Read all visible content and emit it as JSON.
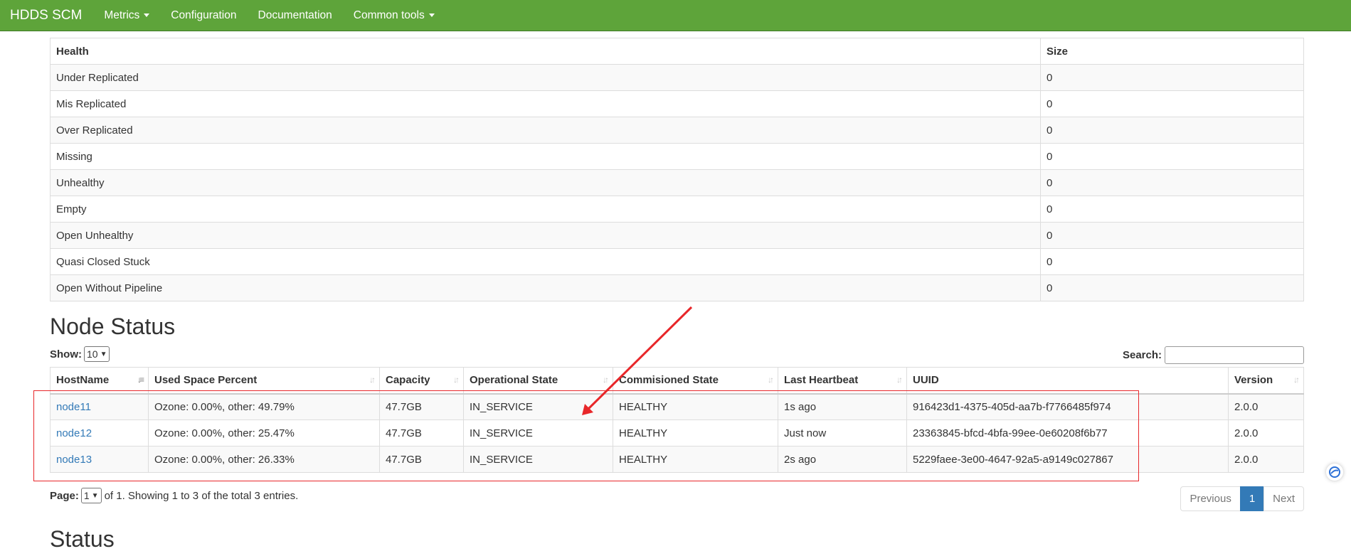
{
  "navbar": {
    "brand": "HDDS SCM",
    "items": [
      {
        "label": "Metrics",
        "dropdown": true
      },
      {
        "label": "Configuration",
        "dropdown": false
      },
      {
        "label": "Documentation",
        "dropdown": false
      },
      {
        "label": "Common tools",
        "dropdown": true
      }
    ]
  },
  "health_table": {
    "headers": [
      "Health",
      "Size"
    ],
    "rows": [
      [
        "Under Replicated",
        "0"
      ],
      [
        "Mis Replicated",
        "0"
      ],
      [
        "Over Replicated",
        "0"
      ],
      [
        "Missing",
        "0"
      ],
      [
        "Unhealthy",
        "0"
      ],
      [
        "Empty",
        "0"
      ],
      [
        "Open Unhealthy",
        "0"
      ],
      [
        "Quasi Closed Stuck",
        "0"
      ],
      [
        "Open Without Pipeline",
        "0"
      ]
    ]
  },
  "node_status": {
    "title": "Node Status",
    "show_label": "Show:",
    "show_value": "10",
    "search_label": "Search:",
    "search_value": "",
    "headers": [
      "HostName",
      "Used Space Percent",
      "Capacity",
      "Operational State",
      "Commisioned State",
      "Last Heartbeat",
      "UUID",
      "Version"
    ],
    "rows": [
      [
        "node11",
        "Ozone: 0.00%, other: 49.79%",
        "47.7GB",
        "IN_SERVICE",
        "HEALTHY",
        "1s ago",
        "916423d1-4375-405d-aa7b-f7766485f974",
        "2.0.0"
      ],
      [
        "node12",
        "Ozone: 0.00%, other: 25.47%",
        "47.7GB",
        "IN_SERVICE",
        "HEALTHY",
        "Just now",
        "23363845-bfcd-4bfa-99ee-0e60208f6b77",
        "2.0.0"
      ],
      [
        "node13",
        "Ozone: 0.00%, other: 26.33%",
        "47.7GB",
        "IN_SERVICE",
        "HEALTHY",
        "2s ago",
        "5229faee-3e00-4647-92a5-a9149c027867",
        "2.0.0"
      ]
    ],
    "page_label": "Page:",
    "page_value": "1",
    "page_summary": "of 1. Showing 1 to 3 of the total 3 entries.",
    "pagination": {
      "previous": "Previous",
      "current": "1",
      "next": "Next"
    }
  },
  "status_section": {
    "title": "Status"
  },
  "colors": {
    "navbar": "#5ea43a",
    "link": "#337ab7",
    "annotation": "#e8272a"
  },
  "icons": [
    "caret-down-icon",
    "sort-icon",
    "chevron-down-icon",
    "assistant-icon"
  ]
}
